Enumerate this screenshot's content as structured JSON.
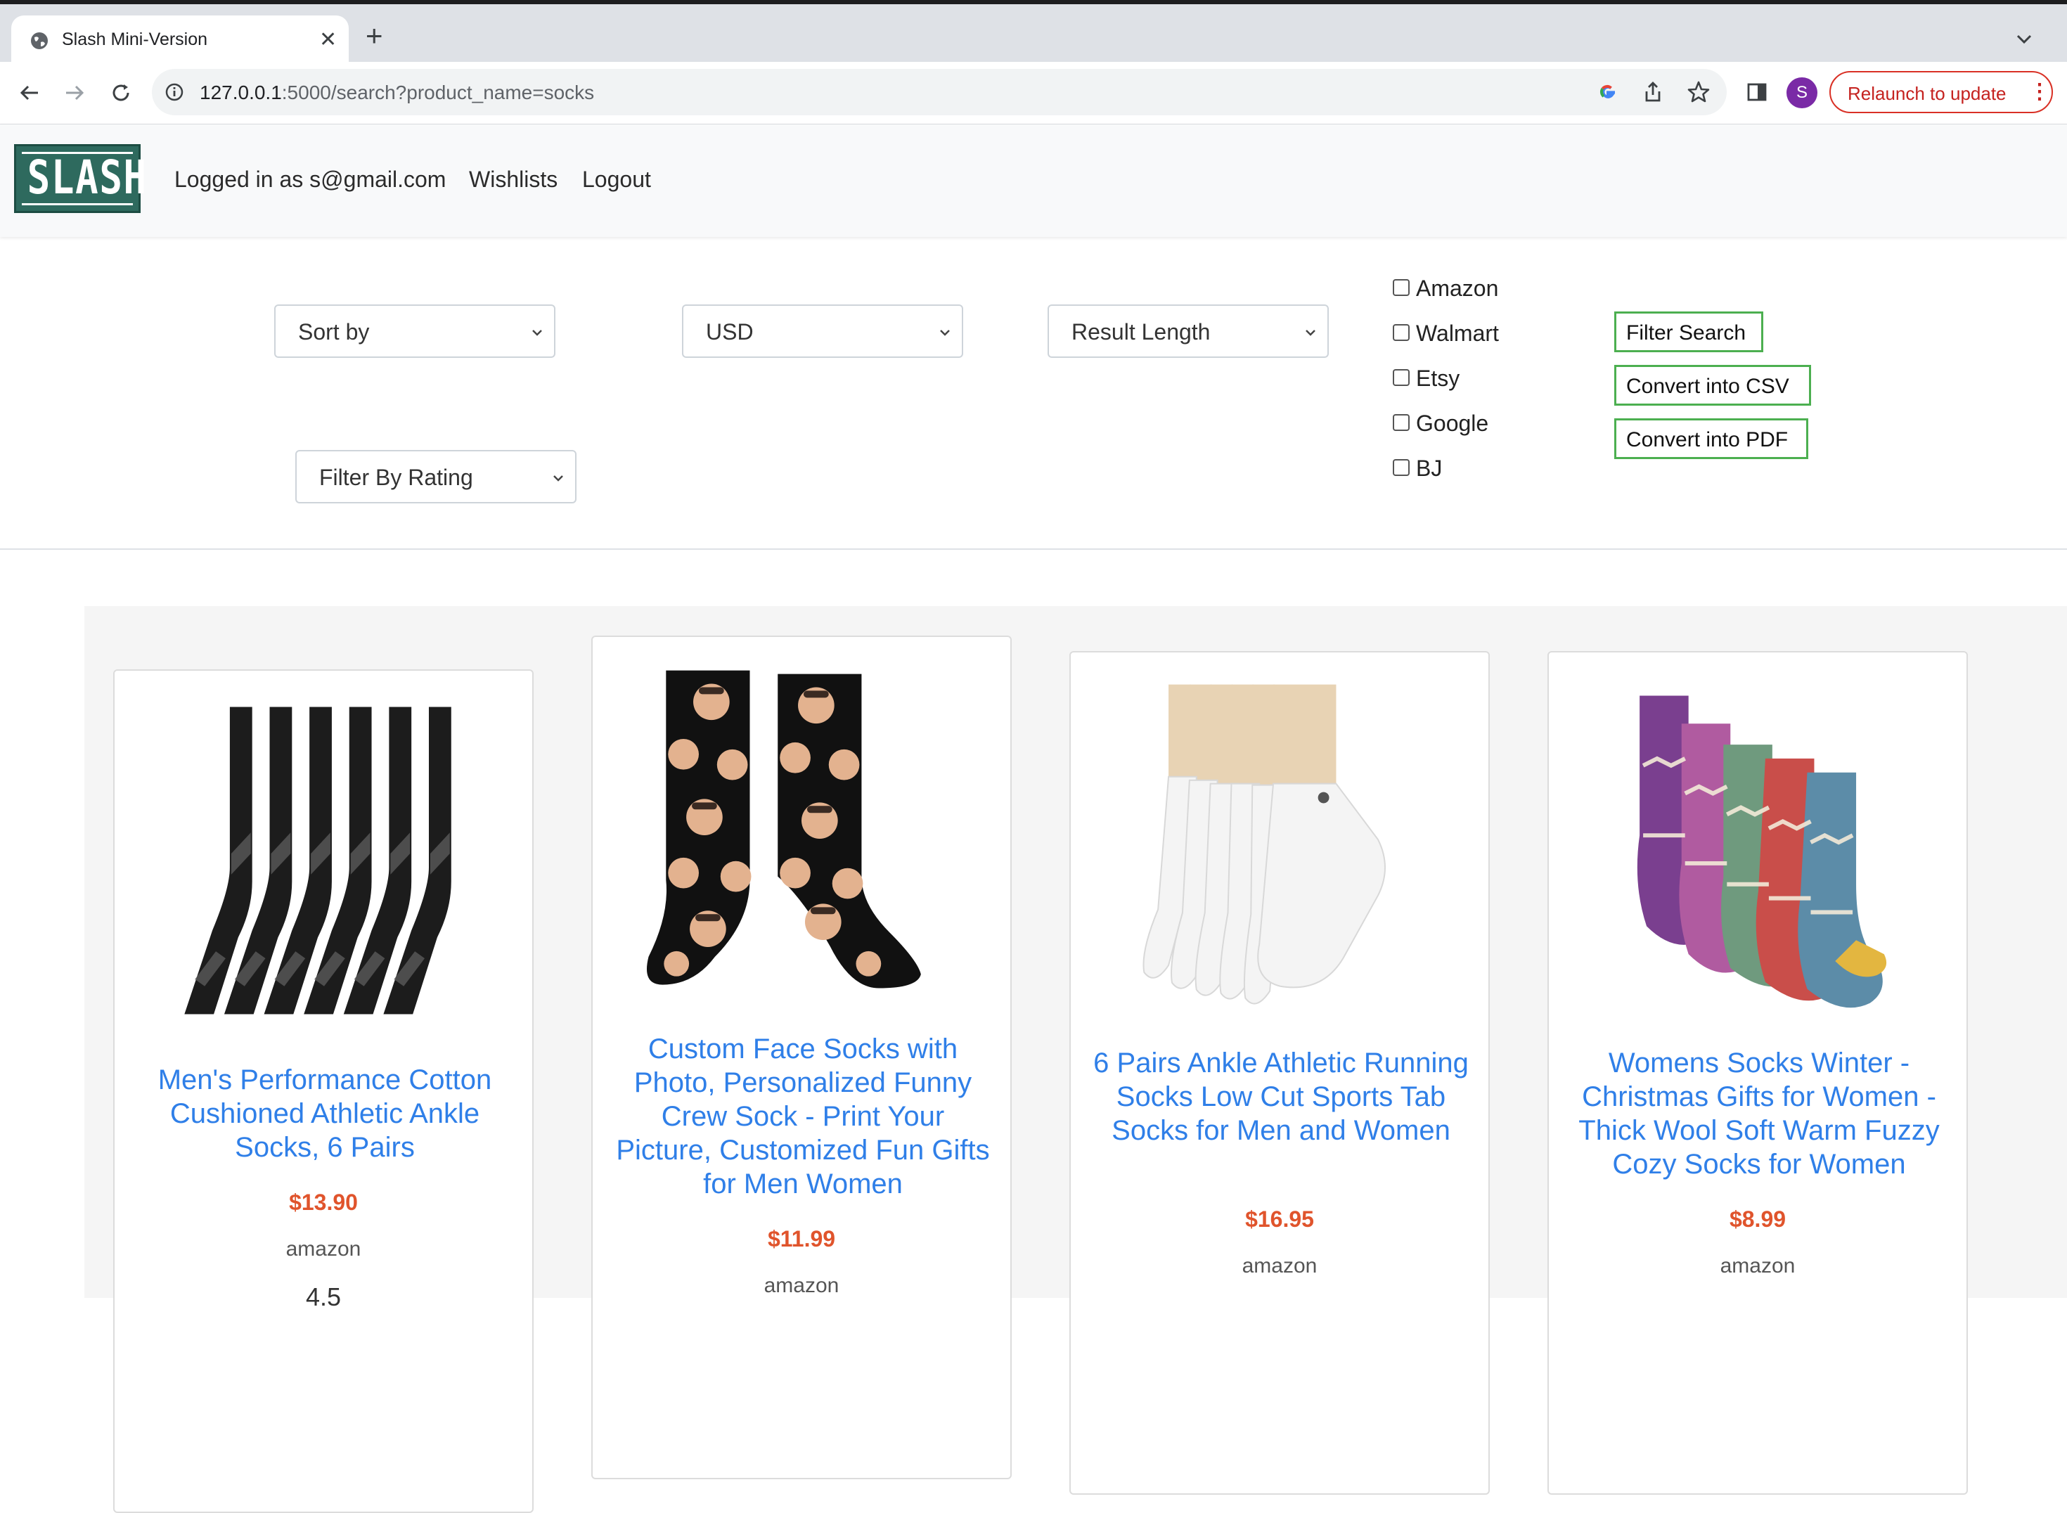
{
  "browser": {
    "tab_title": "Slash Mini-Version",
    "new_tab": "+",
    "url_host": "127.0.0.1",
    "url_path": ":5000/search?product_name=socks",
    "profile_initial": "S",
    "relaunch_label": "Relaunch to update",
    "relaunch_color": "#d93025"
  },
  "navbar": {
    "logo": "SLASH",
    "logged_in": "Logged in as s@gmail.com",
    "wishlists": "Wishlists",
    "logout": "Logout"
  },
  "filters": {
    "sort_by": "Sort by",
    "currency": "USD",
    "result_length": "Result Length",
    "filter_by_rating": "Filter By Rating",
    "websites": [
      {
        "label": "Amazon",
        "checked": false
      },
      {
        "label": "Walmart",
        "checked": false
      },
      {
        "label": "Etsy",
        "checked": false
      },
      {
        "label": "Google",
        "checked": false
      },
      {
        "label": "BJ",
        "checked": false
      }
    ],
    "buttons": {
      "filter_search": "Filter Search",
      "convert_csv": "Convert into CSV",
      "convert_pdf": "Convert into PDF"
    },
    "button_border_color": "#4caf50"
  },
  "results": [
    {
      "title": "Men's Performance Cotton Cushioned Athletic Ankle Socks, 6 Pairs",
      "price": "$13.90",
      "store": "amazon",
      "rating": "4.5",
      "image": "black-athletic-socks"
    },
    {
      "title": "Custom Face Socks with Photo, Personalized Funny Crew Sock - Print Your Picture, Customized Fun Gifts for Men Women",
      "price": "$11.99",
      "store": "amazon",
      "image": "custom-face-socks"
    },
    {
      "title": "6 Pairs Ankle Athletic Running Socks Low Cut Sports Tab Socks for Men and Women",
      "price": "$16.95",
      "store": "amazon",
      "image": "white-ankle-socks"
    },
    {
      "title": "Womens Socks Winter - Christmas Gifts for Women - Thick Wool Soft Warm Fuzzy Cozy Socks for Women",
      "price": "$8.99",
      "store": "amazon",
      "image": "wool-winter-socks"
    }
  ],
  "colors": {
    "title_link": "#2f7fe8",
    "price": "#e0542c"
  }
}
